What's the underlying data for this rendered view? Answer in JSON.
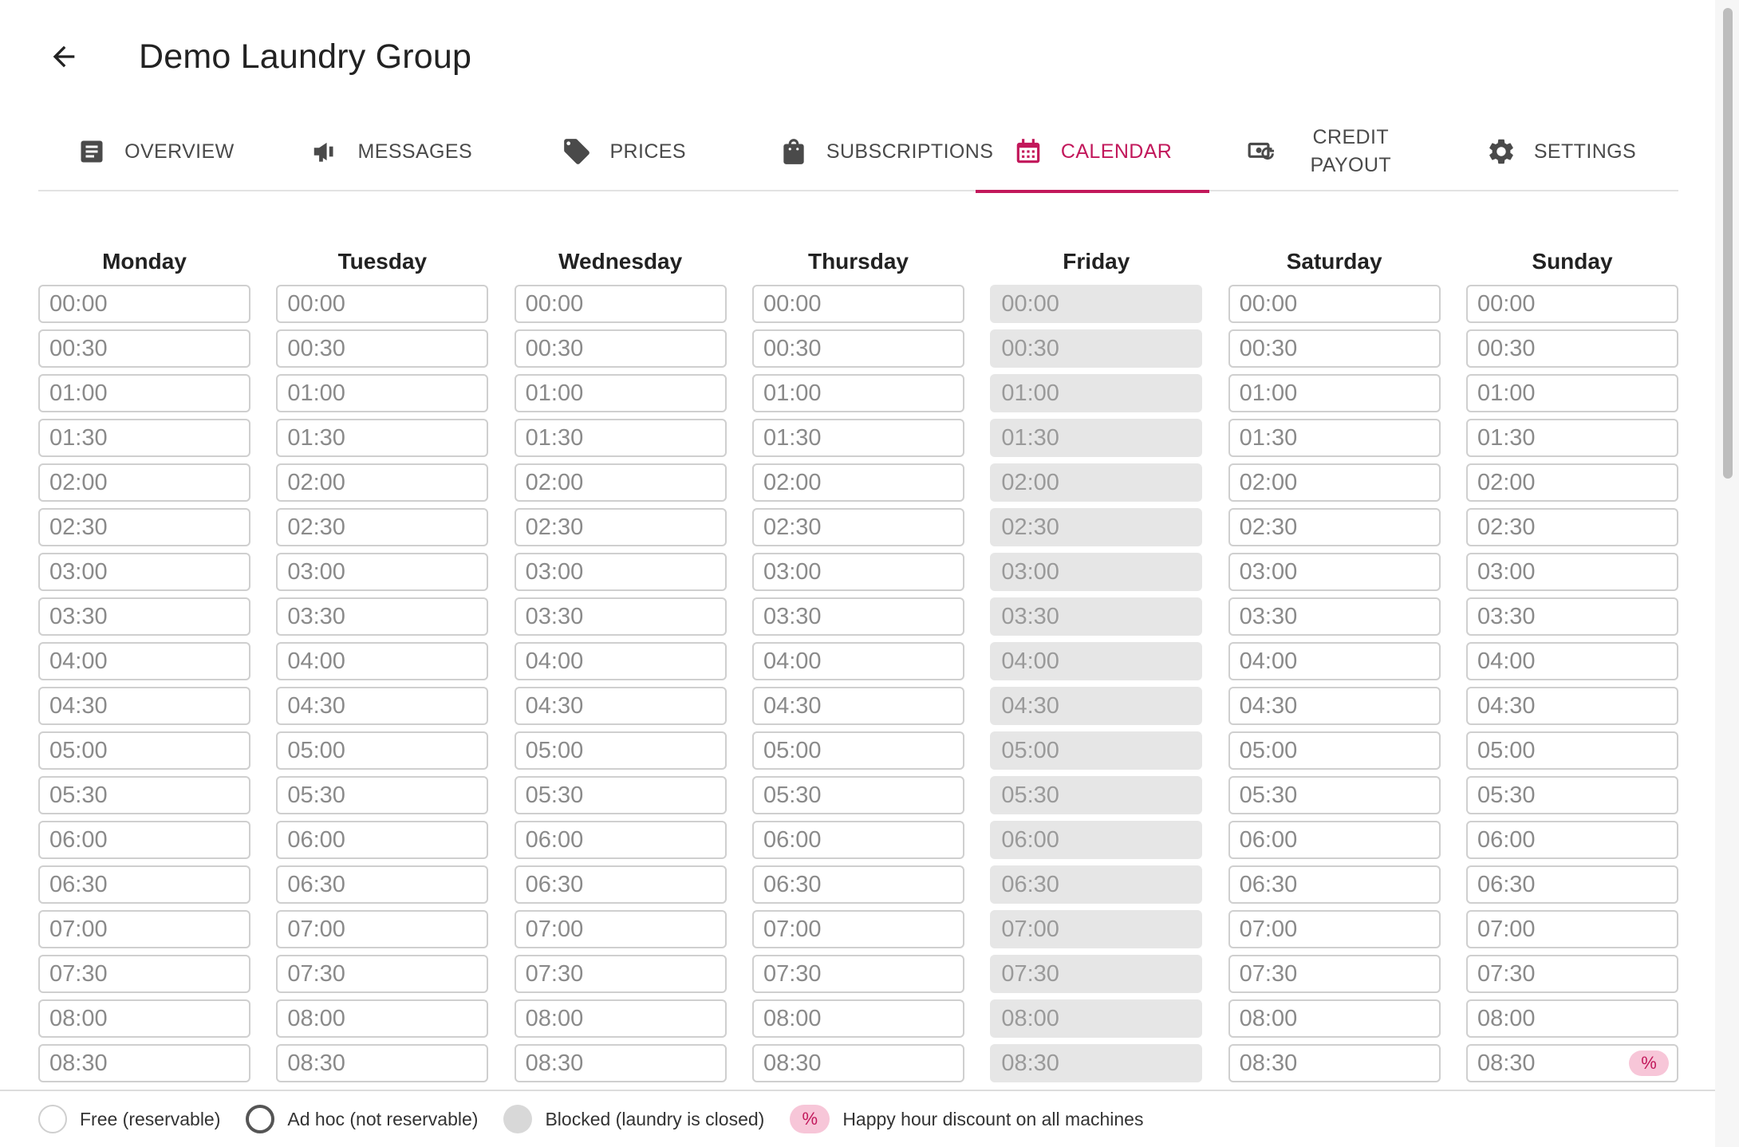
{
  "header": {
    "title": "Demo Laundry Group",
    "back_icon": "arrow-left-icon"
  },
  "tabs": [
    {
      "id": "overview",
      "label": "OVERVIEW",
      "icon": "document-icon",
      "active": false
    },
    {
      "id": "messages",
      "label": "MESSAGES",
      "icon": "megaphone-icon",
      "active": false
    },
    {
      "id": "prices",
      "label": "PRICES",
      "icon": "price-tag-icon",
      "active": false
    },
    {
      "id": "subscriptions",
      "label": "SUBSCRIPTIONS",
      "icon": "shopping-bag-icon",
      "active": false
    },
    {
      "id": "calendar",
      "label": "CALENDAR",
      "icon": "calendar-icon",
      "active": true
    },
    {
      "id": "credit-payout",
      "label": "CREDIT PAYOUT",
      "icon": "money-refresh-icon",
      "active": false
    },
    {
      "id": "settings",
      "label": "SETTINGS",
      "icon": "gear-icon",
      "active": false
    }
  ],
  "calendar": {
    "times": [
      "00:00",
      "00:30",
      "01:00",
      "01:30",
      "02:00",
      "02:30",
      "03:00",
      "03:30",
      "04:00",
      "04:30",
      "05:00",
      "05:30",
      "06:00",
      "06:30",
      "07:00",
      "07:30",
      "08:00",
      "08:30"
    ],
    "days": [
      {
        "name": "Monday",
        "status": "free"
      },
      {
        "name": "Tuesday",
        "status": "free"
      },
      {
        "name": "Wednesday",
        "status": "free"
      },
      {
        "name": "Thursday",
        "status": "free"
      },
      {
        "name": "Friday",
        "status": "blocked"
      },
      {
        "name": "Saturday",
        "status": "free"
      },
      {
        "name": "Sunday",
        "status": "free",
        "happy_hour_slots": [
          "08:30"
        ]
      }
    ],
    "happy_hour_badge": "%"
  },
  "legend": {
    "free": "Free (reservable)",
    "adhoc": "Ad hoc (not reservable)",
    "blocked": "Blocked (laundry is closed)",
    "happy_hour": "Happy hour discount on all machines",
    "happy_hour_symbol": "%"
  },
  "colors": {
    "accent": "#c2185b",
    "happy_hour_bg": "#f7c6d8",
    "blocked_bg": "#e6e6e6",
    "slot_border": "#cfcfcf"
  }
}
